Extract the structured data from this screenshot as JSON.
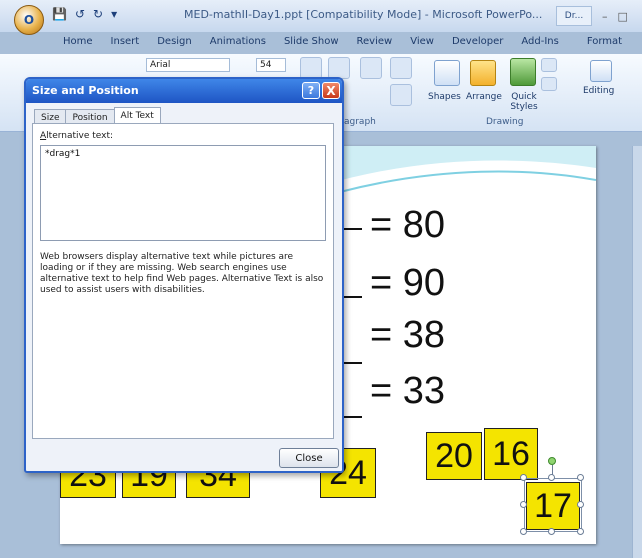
{
  "window": {
    "title": "MED-mathII-Day1.ppt [Compatibility Mode] - Microsoft PowerPo...",
    "dr_label": "Dr...",
    "office_button_label": "O"
  },
  "ribbon": {
    "tabs": [
      "Home",
      "Insert",
      "Design",
      "Animations",
      "Slide Show",
      "Review",
      "View",
      "Developer",
      "Add-Ins",
      "Format"
    ],
    "active_tab": "Home",
    "font_name": "Arial",
    "font_size": "54",
    "groups": {
      "paragraph": "agraph",
      "drawing": "Drawing",
      "editing": "Editing",
      "shapes": "Shapes",
      "arrange": "Arrange",
      "quick_styles": "Quick Styles"
    },
    "qat_icons": [
      "save-icon",
      "undo-icon",
      "redo-icon",
      "customize-icon"
    ]
  },
  "dialog": {
    "title": "Size and Position",
    "help_label": "?",
    "close_x": "X",
    "tabs": [
      "Size",
      "Position",
      "Alt Text"
    ],
    "active_tab": "Alt Text",
    "alt_label_prefix": "A",
    "alt_label_rest": "lternative text:",
    "alt_text_value": "*drag*1",
    "help_text": "Web browsers display alternative text while pictures are loading or if they are missing.  Web search engines use alternative text to help find Web pages.  Alternative Text is also used to assist users with disabilities.",
    "close_button": "Close"
  },
  "slide": {
    "equations": [
      "= 80",
      "= 90",
      "= 38",
      "= 33"
    ],
    "tiles": [
      "23",
      "19",
      "34",
      "24",
      "20",
      "16",
      "17"
    ],
    "selected_tile": "17"
  },
  "colors": {
    "tile_fill": "#f4e400",
    "dialog_title": "#2d63c8",
    "workspace": "#a9bfd8"
  }
}
